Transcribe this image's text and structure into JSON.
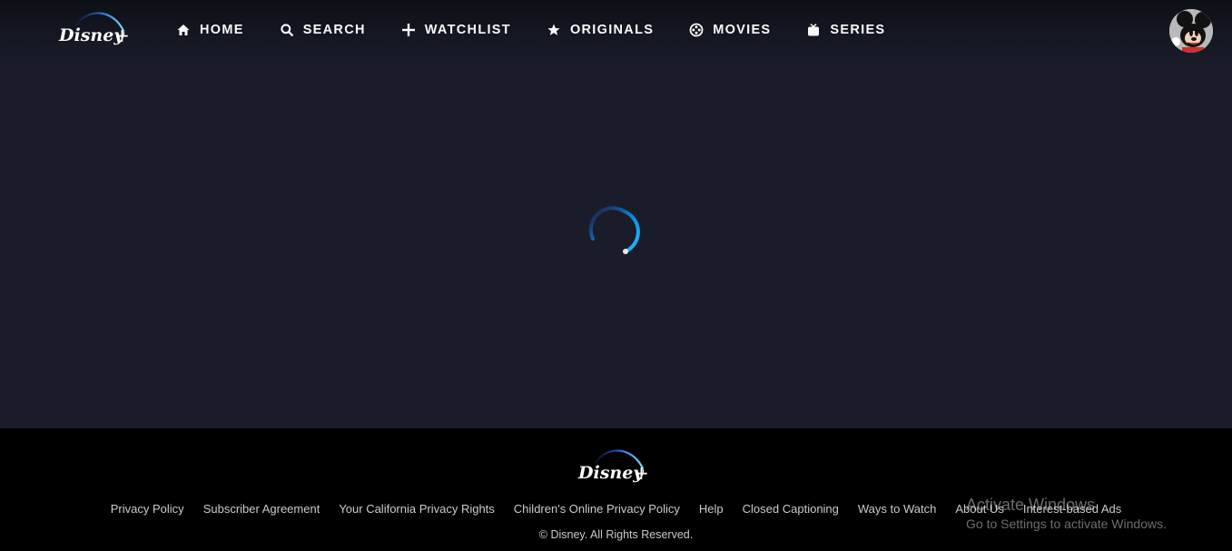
{
  "header": {
    "logo_text": "Disney+",
    "nav": [
      {
        "label": "HOME",
        "icon": "home-icon"
      },
      {
        "label": "SEARCH",
        "icon": "search-icon"
      },
      {
        "label": "WATCHLIST",
        "icon": "plus-icon"
      },
      {
        "label": "ORIGINALS",
        "icon": "star-icon"
      },
      {
        "label": "MOVIES",
        "icon": "film-reel-icon"
      },
      {
        "label": "SERIES",
        "icon": "tv-icon"
      }
    ],
    "avatar_icon": "mickey-mouse-avatar-icon"
  },
  "main": {
    "loading_icon": "loading-spinner-icon"
  },
  "footer": {
    "logo_text": "Disney+",
    "links": [
      "Privacy Policy",
      "Subscriber Agreement",
      "Your California Privacy Rights",
      "Children's Online Privacy Policy",
      "Help",
      "Closed Captioning",
      "Ways to Watch",
      "About Us",
      "Interest-based Ads"
    ],
    "copyright": "© Disney. All Rights Reserved."
  },
  "watermark": {
    "title": "Activate Windows",
    "subtitle": "Go to Settings to activate Windows."
  },
  "colors": {
    "background": "#1a1d29",
    "footer": "#000000",
    "text": "#f9f9f9",
    "accent": "#0aa3e9"
  }
}
